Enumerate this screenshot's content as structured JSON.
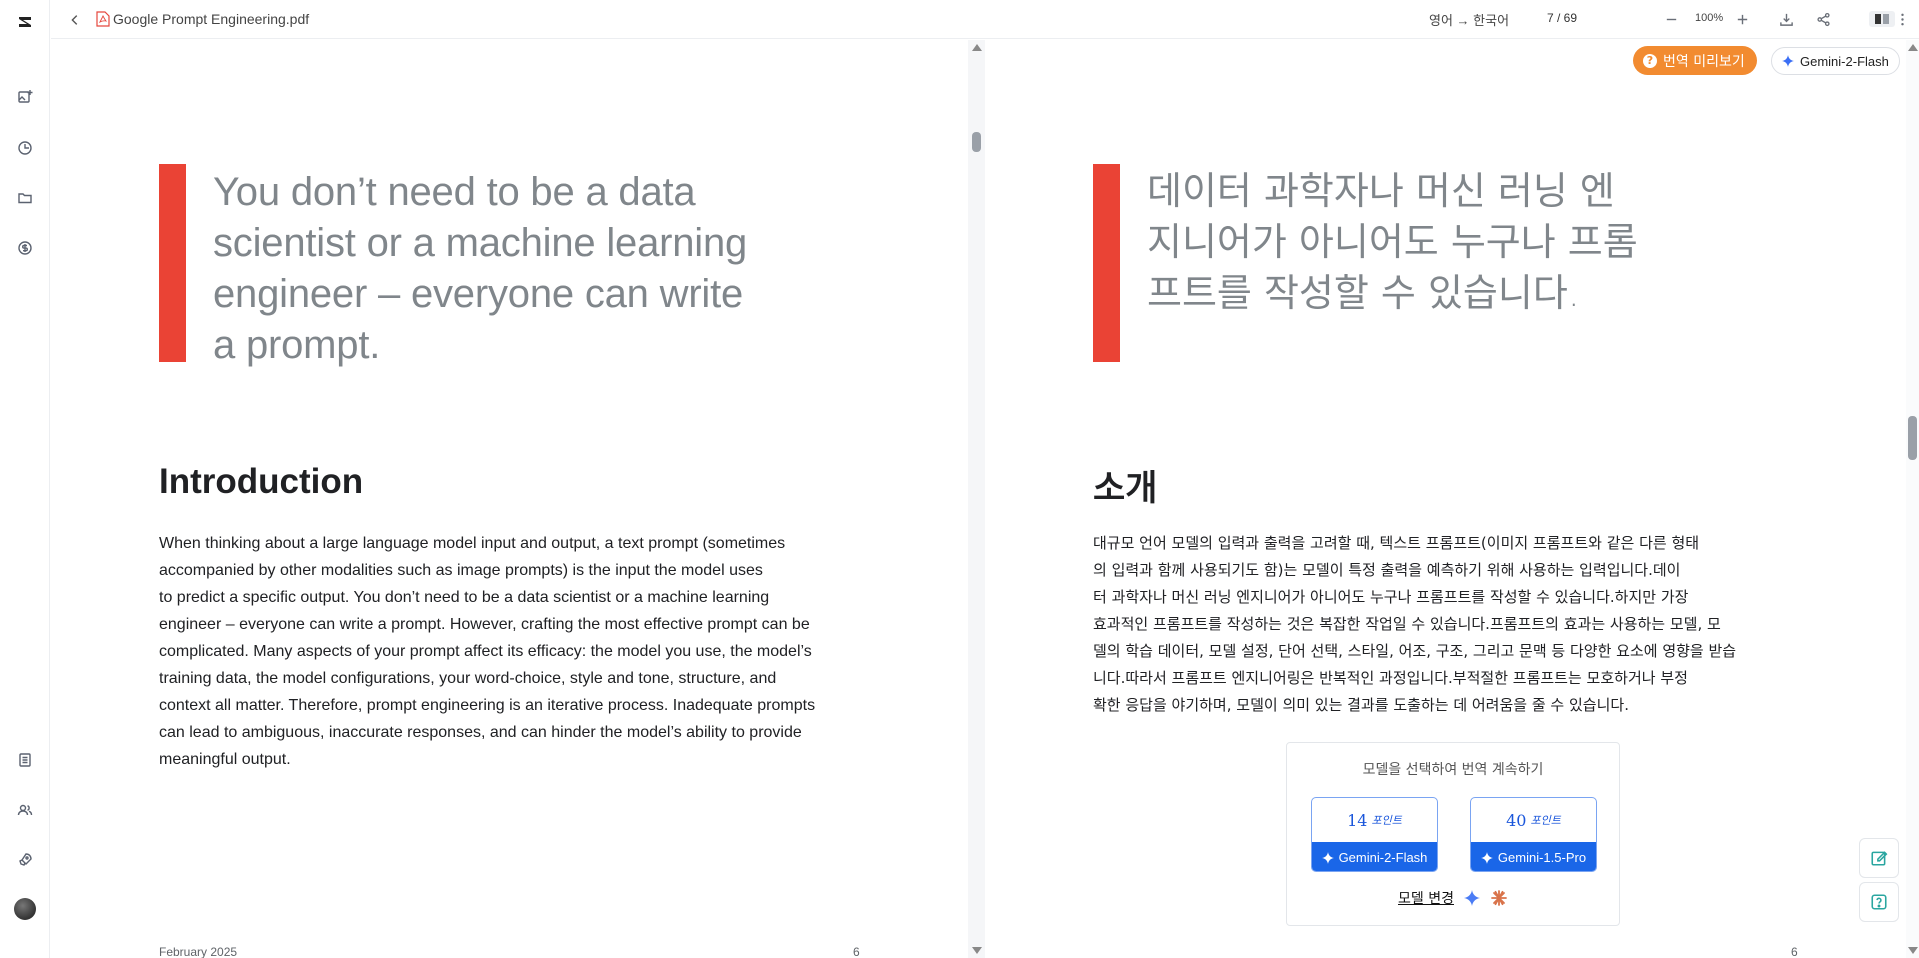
{
  "file": {
    "name": "Google Prompt Engineering.pdf"
  },
  "toolbar": {
    "language_pair": "영어 → 한국어",
    "page_indicator": "7 / 69",
    "zoom": "100%"
  },
  "overlay": {
    "preview_button": "번역 미리보기",
    "model_chip": "Gemini-2-Flash"
  },
  "left_page": {
    "quote_lines": [
      "You don’t need to be a data",
      "scientist or a machine learning",
      "engineer – everyone can write",
      "a prompt."
    ],
    "section_title": "Introduction",
    "body_lines": [
      "When thinking about a large language model input and output, a text prompt (sometimes",
      "accompanied by other modalities such as image prompts) is the input the model uses",
      "to predict a specific output. You don’t need to be a data scientist or a machine learning",
      "engineer – everyone can write a prompt. However, crafting the most effective prompt can be",
      "complicated. Many aspects of your prompt affect its efficacy: the model you use, the model’s",
      "training data, the model configurations, your word-choice, style and tone, structure, and",
      "context all matter. Therefore, prompt engineering is an iterative process. Inadequate prompts",
      "can lead to ambiguous, inaccurate responses, and can hinder the model’s ability to provide",
      "meaningful output."
    ],
    "footer_date": "February 2025",
    "footer_page": "6"
  },
  "right_page": {
    "quote_lines": [
      "데이터 과학자나 머신 러닝 엔",
      "지니어가 아니어도 누구나 프롬",
      "프트를 작성할 수 있습니다."
    ],
    "section_title": "소개",
    "body_lines": [
      "대규모 언어 모델의 입력과 출력을 고려할 때, 텍스트 프롬프트(이미지 프롬프트와 같은 다른 형태",
      "의 입력과 함께 사용되기도 함)는 모델이 특정 출력을 예측하기 위해 사용하는 입력입니다.데이",
      "터 과학자나 머신 러닝 엔지니어가 아니어도 누구나 프롬프트를 작성할 수 있습니다.하지만 가장",
      "효과적인 프롬프트를 작성하는 것은 복잡한 작업일 수 있습니다.프롬프트의 효과는 사용하는 모델, 모",
      "델의 학습 데이터, 모델 설정, 단어 선택, 스타일, 어조, 구조, 그리고 문맥 등 다양한 요소에 영향을 받습",
      "니다.따라서 프롬프트 엔지니어링은 반복적인 과정입니다.부적절한 프롬프트는 모호하거나 부정",
      "확한 응답을 야기하며, 모델이 의미 있는 결과를 도출하는 데 어려움을 줄 수 있습니다."
    ],
    "footer_page": "6"
  },
  "translate_card": {
    "title": "모델을 선택하여 번역 계속하기",
    "options": [
      {
        "points": "14",
        "unit": "포인트",
        "model": "Gemini-2-Flash"
      },
      {
        "points": "40",
        "unit": "포인트",
        "model": "Gemini-1.5-Pro"
      }
    ],
    "change_model": "모델 변경"
  },
  "colors": {
    "accent_red": "#ea4335",
    "preview_orange": "#f28b30",
    "model_blue": "#1a66e8",
    "float_teal": "#2aa6a0"
  },
  "icons": {
    "rail": [
      "logo-icon",
      "add-image-icon",
      "history-icon",
      "folder-icon",
      "coin-icon",
      "document-list-icon",
      "users-icon",
      "rocket-icon"
    ],
    "toolbar": [
      "back-icon",
      "pdf-file-icon",
      "zoom-out-icon",
      "zoom-in-icon",
      "download-icon",
      "share-icon",
      "layout-split-icon",
      "more-icon"
    ],
    "floating": [
      "edit-icon",
      "help-icon"
    ]
  }
}
